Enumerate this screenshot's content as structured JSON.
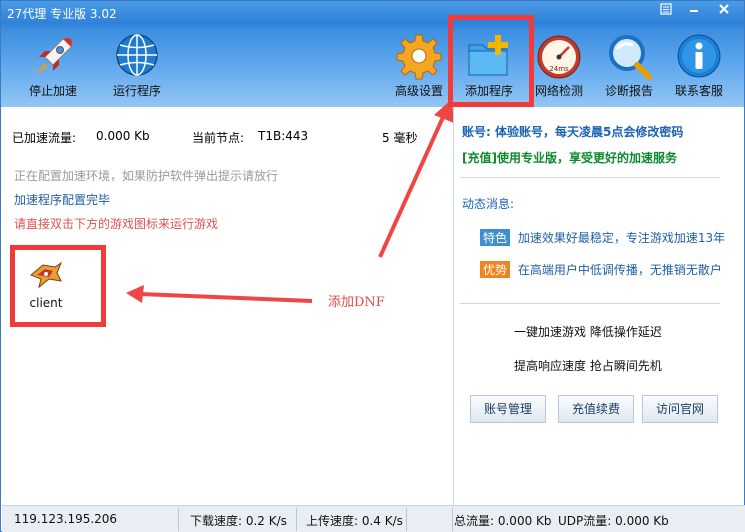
{
  "window": {
    "title": "27代理 专业版 3.02",
    "min_icon": "minimize-icon",
    "close_icon": "close-icon",
    "menu_icon": "menu-icon"
  },
  "toolbar": {
    "stop_accel": "停止加速",
    "run_program": "运行程序",
    "advanced_settings": "高级设置",
    "add_program": "添加程序",
    "net_detect": "网络检测",
    "diagnostic": "诊断报告",
    "support": "联系客服",
    "net_detect_badge": "24ms"
  },
  "stats": {
    "accel_traffic_label": "已加速流量:",
    "accel_traffic_value": "0.000 Kb",
    "current_node_label": "当前节点:",
    "current_node_value": "T1B:443",
    "latency": "5 毫秒"
  },
  "messages": {
    "configuring": "正在配置加速环境，如果防护软件弹出提示请放行",
    "done": "加速程序配置完毕",
    "instruction": "请直接双击下方的游戏图标来运行游戏"
  },
  "games": [
    {
      "label": "client"
    }
  ],
  "annotation": {
    "arrow_label": "添加DNF"
  },
  "account": {
    "line": "账号:  体验账号，每天凌晨5点会修改密码",
    "upgrade": "[充值]使用专业版，享受更好的加速服务"
  },
  "news": {
    "heading": "动态消息:",
    "items": [
      {
        "badge": "特色",
        "text": "加速效果好最稳定，专注游戏加速13年",
        "badge_color": "#3d8fd0"
      },
      {
        "badge": "优势",
        "text": "在高端用户中低调传播，无推销无散户",
        "badge_color": "#f0841e"
      }
    ]
  },
  "slogans": {
    "line1": "一键加速游戏  降低操作延迟",
    "line2": "提高响应速度  抢占瞬间先机"
  },
  "buttons": {
    "account_mgmt": "账号管理",
    "recharge": "充值续费",
    "visit_site": "访问官网"
  },
  "status": {
    "ip": "119.123.195.206",
    "download": "下载速度: 0.2 K/s",
    "upload": "上传速度: 0.4 K/s",
    "total": "总流量: 0.000 Kb",
    "udp": "UDP流量: 0.000 Kb"
  }
}
